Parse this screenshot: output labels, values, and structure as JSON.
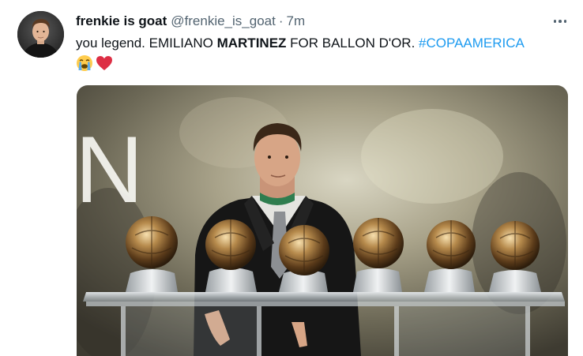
{
  "tweet": {
    "display_name": "frenkie is goat",
    "handle": "@frenkie_is_goat",
    "separator": "·",
    "time": "7m",
    "text": {
      "intro": "you legend. EMILIANO ",
      "bold": "MARTINEZ",
      "rest": " FOR BALLON D'OR. ",
      "hashtag": "#COPAAMERICA"
    },
    "emojis": [
      "crying-face-emoji",
      "red-heart-emoji"
    ],
    "media": {
      "backdrop_letter": "N",
      "trophy_count": 6
    }
  },
  "colors": {
    "text": "#0f1419",
    "secondary": "#536471",
    "link": "#1d9bf0",
    "heart": "#e0245e"
  }
}
